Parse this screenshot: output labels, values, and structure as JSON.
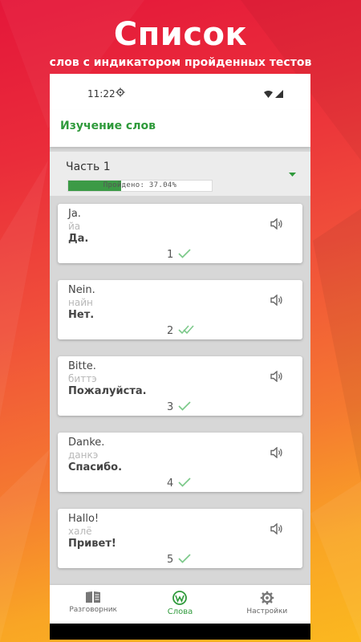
{
  "promo": {
    "title": "Список",
    "subtitle": "слов с индикатором пройденных тестов"
  },
  "status_bar": {
    "time": "11:22",
    "icons": [
      "gear-icon",
      "wifi-icon",
      "signal-icon"
    ]
  },
  "app_bar": {
    "title": "Изучение слов"
  },
  "section": {
    "title": "Часть 1",
    "progress_label": "Пройдено: 37.04%",
    "progress_fraction": 0.3704
  },
  "words": [
    {
      "de": "Ja.",
      "tr": "йа",
      "ru": "Да.",
      "number": "1",
      "status": "single-check"
    },
    {
      "de": "Nein.",
      "tr": "найн",
      "ru": "Нет.",
      "number": "2",
      "status": "double-check"
    },
    {
      "de": "Bitte.",
      "tr": "биттэ",
      "ru": "Пожалуйста.",
      "number": "3",
      "status": "single-check"
    },
    {
      "de": "Danke.",
      "tr": "данкэ",
      "ru": "Спасибо.",
      "number": "4",
      "status": "single-check"
    },
    {
      "de": "Hallo!",
      "tr": "халё",
      "ru": "Привет!",
      "number": "5",
      "status": "single-check"
    }
  ],
  "bottom_nav": [
    {
      "label": "Разговорник",
      "icon": "book-icon",
      "active": false
    },
    {
      "label": "Слова",
      "icon": "wordpress-icon",
      "active": true
    },
    {
      "label": "Настройки",
      "icon": "gear-icon",
      "active": false
    }
  ],
  "colors": {
    "accent_green": "#2f9a3b",
    "progress_green": "#3c9a46",
    "check_green": "#7cc98a"
  }
}
